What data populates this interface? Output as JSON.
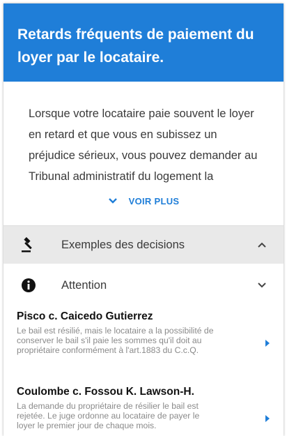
{
  "header": {
    "title": "Retards fréquents de paiement du loyer par le locataire."
  },
  "body": {
    "text": "Lorsque votre locataire paie souvent le loyer en retard et que vous en subissez un préjudice sérieux, vous pouvez demander au Tribunal administratif du logement la",
    "voir_plus_label": "VOIR PLUS",
    "voir_plus_icon": "chevron-down-icon"
  },
  "sections": {
    "examples": {
      "label": "Exemples des decisions",
      "icon": "gavel-icon",
      "chevron": "chevron-up-icon"
    },
    "attention": {
      "label": "Attention",
      "icon": "info-icon",
      "chevron": "chevron-down-icon"
    }
  },
  "decisions": [
    {
      "title": "Pisco c. Caicedo Gutierrez",
      "description": "Le bail est résilié, mais le locataire a la possibilité de conserver le bail s'il paie les sommes qu'il doit au propriétaire conformément à l'art.1883 du C.c.Q."
    },
    {
      "title": "Coulombe c. Fossou K. Lawson-H.",
      "description": "La demande du propriétaire de résilier le bail est rejetée. Le juge ordonne au locataire de payer le loyer le premier jour de chaque mois."
    }
  ],
  "colors": {
    "accent": "#1f7ed8",
    "section_bg": "#e9e9e9"
  }
}
